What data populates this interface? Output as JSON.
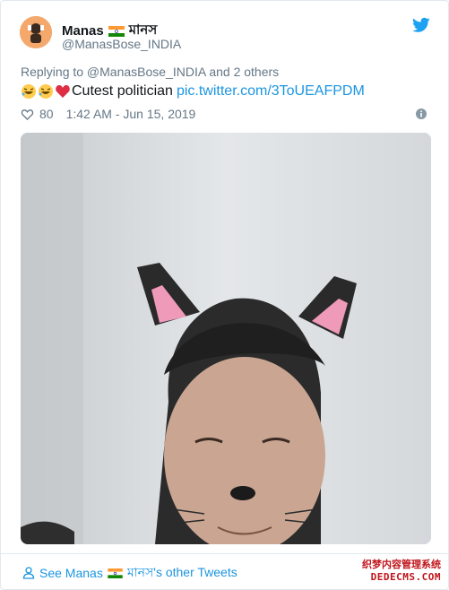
{
  "tweet": {
    "display_name": "Manas",
    "bengali_name": "মানস",
    "handle": "@ManasBose_INDIA",
    "reply_to": "Replying to @ManasBose_INDIA and 2 others",
    "text": "Cutest politician",
    "link": "pic.twitter.com/3ToUEAFPDM",
    "likes": "80",
    "timestamp": "1:42 AM - Jun 15, 2019"
  },
  "footer": {
    "see_label": "See Manas",
    "other_tweets": "মানস's other Tweets"
  },
  "watermark": {
    "line1": "织梦内容管理系统",
    "line2": "DEDECMS.COM"
  },
  "icons": {
    "bird": "twitter-bird-icon",
    "heart": "heart-icon",
    "info": "info-icon",
    "person": "person-icon",
    "flag": "india-flag-icon",
    "laugh": "rolling-laughing-emoji",
    "red_heart": "red-heart-emoji"
  },
  "colors": {
    "link": "#1b95e0",
    "muted": "#657786",
    "text": "#14171a",
    "border": "#e1e8ed"
  }
}
